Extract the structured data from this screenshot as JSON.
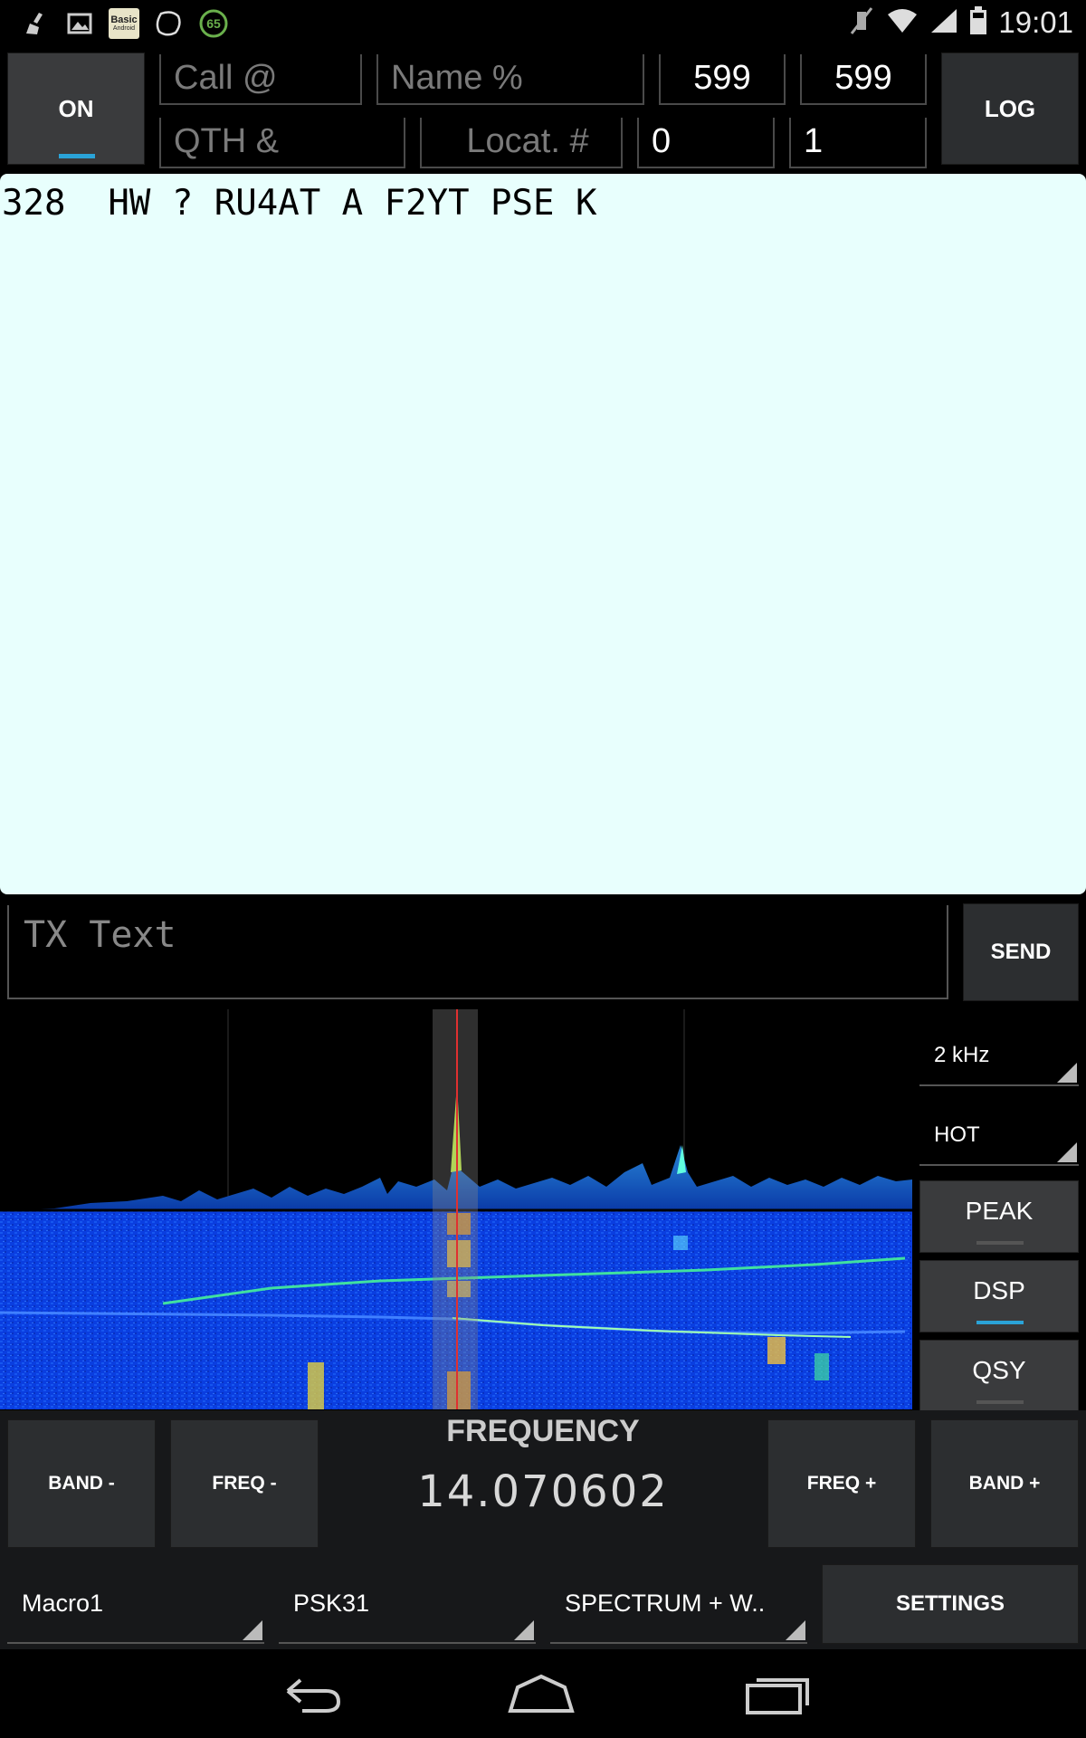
{
  "status_bar": {
    "time": "19:01",
    "notification_icons": [
      "broom-icon",
      "image-icon",
      "basic-android-icon",
      "blob-icon",
      "badge-65-icon"
    ],
    "badge_text": "65",
    "basic_label_line1": "Basic",
    "basic_label_line2": "Android"
  },
  "header": {
    "on_label": "ON",
    "log_label": "LOG",
    "call_placeholder": "Call @",
    "name_placeholder": "Name %",
    "rst_sent": "599",
    "rst_rcvd": "599",
    "qth_placeholder": "QTH &",
    "locator_placeholder": "Locat. #",
    "serial_sent": "0",
    "serial_rcvd": "1"
  },
  "rx": {
    "text": "328  HW ? RU4AT A F2YT PSE K"
  },
  "tx": {
    "placeholder": "TX Text",
    "send_label": "SEND"
  },
  "waterfall_controls": {
    "bandwidth": "2 kHz",
    "palette": "HOT",
    "peak_label": "PEAK",
    "dsp_label": "DSP",
    "qsy_label": "QSY"
  },
  "frequency": {
    "title": "FREQUENCY",
    "value": "14.070602",
    "band_minus": "BAND -",
    "freq_minus": "FREQ -",
    "freq_plus": "FREQ +",
    "band_plus": "BAND +"
  },
  "bottom": {
    "macro": "Macro1",
    "mode": "PSK31",
    "view": "SPECTRUM + W..",
    "settings_label": "SETTINGS"
  },
  "colors": {
    "accent": "#2aa3d8",
    "rx_background": "#e8fffd",
    "button": "#2c2e30"
  }
}
